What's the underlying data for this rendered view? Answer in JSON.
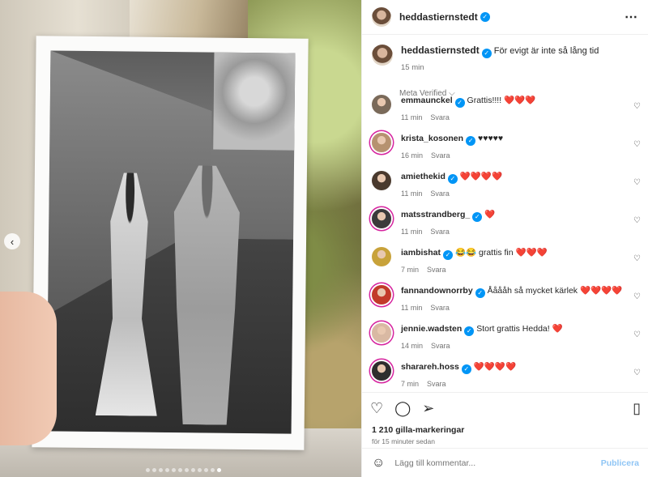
{
  "post": {
    "username": "heddastiernstedt",
    "caption": "För evigt är inte så lång tid",
    "caption_time": "15 min",
    "meta_verified": "Meta Verified",
    "more_icon": "⋯"
  },
  "comments": [
    {
      "user": "emmaunckel",
      "text": "Grattis!!!! ❤️❤️❤️",
      "time": "11 min",
      "reply": "Svara",
      "avatar_color": "#7a6a5a",
      "ring": false
    },
    {
      "user": "krista_kosonen",
      "text": "♥♥♥♥♥",
      "time": "16 min",
      "reply": "Svara",
      "avatar_color": "#b69270",
      "ring": true
    },
    {
      "user": "amiethekid",
      "text": "❤️❤️❤️❤️",
      "time": "11 min",
      "reply": "Svara",
      "avatar_color": "#4a3a2e",
      "ring": false
    },
    {
      "user": "matsstrandberg_",
      "text": "❤️",
      "time": "11 min",
      "reply": "Svara",
      "avatar_color": "#3b3b3b",
      "ring": true
    },
    {
      "user": "iambishat",
      "text": "😂😂 grattis fin ❤️❤️❤️",
      "time": "7 min",
      "reply": "Svara",
      "avatar_color": "#c8a23a",
      "ring": false
    },
    {
      "user": "fannandownorrby",
      "text": "Ååååh så mycket kärlek ❤️❤️❤️❤️",
      "time": "11 min",
      "reply": "Svara",
      "avatar_color": "#c23a2a",
      "ring": true
    },
    {
      "user": "jennie.wadsten",
      "text": "Stort grattis Hedda! ❤️",
      "time": "14 min",
      "reply": "Svara",
      "avatar_color": "#d9b9a3",
      "ring": true
    },
    {
      "user": "sharareh.hoss",
      "text": "❤️❤️❤️❤️",
      "time": "7 min",
      "reply": "Svara",
      "avatar_color": "#2e2e2e",
      "ring": true
    }
  ],
  "engagement": {
    "likes": "1 210 gilla-markeringar",
    "posted_ago": "för 15 minuter sedan"
  },
  "composer": {
    "placeholder": "Lägg till kommentar...",
    "post_label": "Publicera"
  },
  "carousel": {
    "total_slides": 12,
    "active_slide": 12
  },
  "colors": {
    "accent": "#0095f6",
    "heart": "#ed1c24",
    "muted": "#737373"
  }
}
